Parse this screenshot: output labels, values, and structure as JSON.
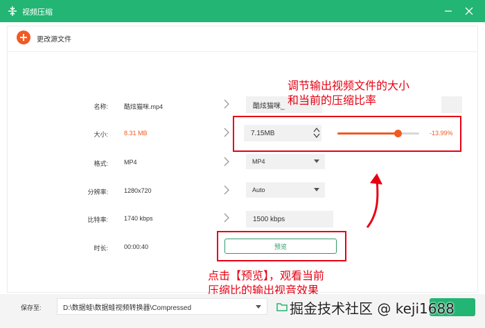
{
  "window": {
    "title": "视频压缩",
    "accent": "#22b573"
  },
  "toolbar": {
    "change_source_label": "更改源文件"
  },
  "source": {
    "name_label": "名称:",
    "name_value": "酷炫猫咪.mp4",
    "size_label": "大小:",
    "size_value": "8.31 MB",
    "format_label": "格式:",
    "format_value": "MP4",
    "resolution_label": "分辨率:",
    "resolution_value": "1280x720",
    "bitrate_label": "比特率:",
    "bitrate_value": "1740 kbps",
    "duration_label": "时长:",
    "duration_value": "00:00:40"
  },
  "output": {
    "name_value": "酷炫猫咪_",
    "size_value": "7.15MB",
    "compression_percent": "-13.99%",
    "slider_level": 0.74,
    "format_value": "MP4",
    "resolution_value": "Auto",
    "bitrate_value": "1500 kbps",
    "preview_label": "预览"
  },
  "annotations": {
    "top_line1": "调节输出视频文件的大小",
    "top_line2": "和当前的压缩比率",
    "bottom_line1": "点击【预览】，观看当前",
    "bottom_line2": "压缩比的输出视音效果"
  },
  "footer": {
    "save_label": "保存至:",
    "save_path": "D:\\数据蛙\\数据蛙视频转换器\\Compressed",
    "watermark": "掘金技术社区 @ keji1688"
  },
  "colors": {
    "orange": "#f15a24",
    "red_annotation": "#e60012",
    "green": "#22b573"
  }
}
